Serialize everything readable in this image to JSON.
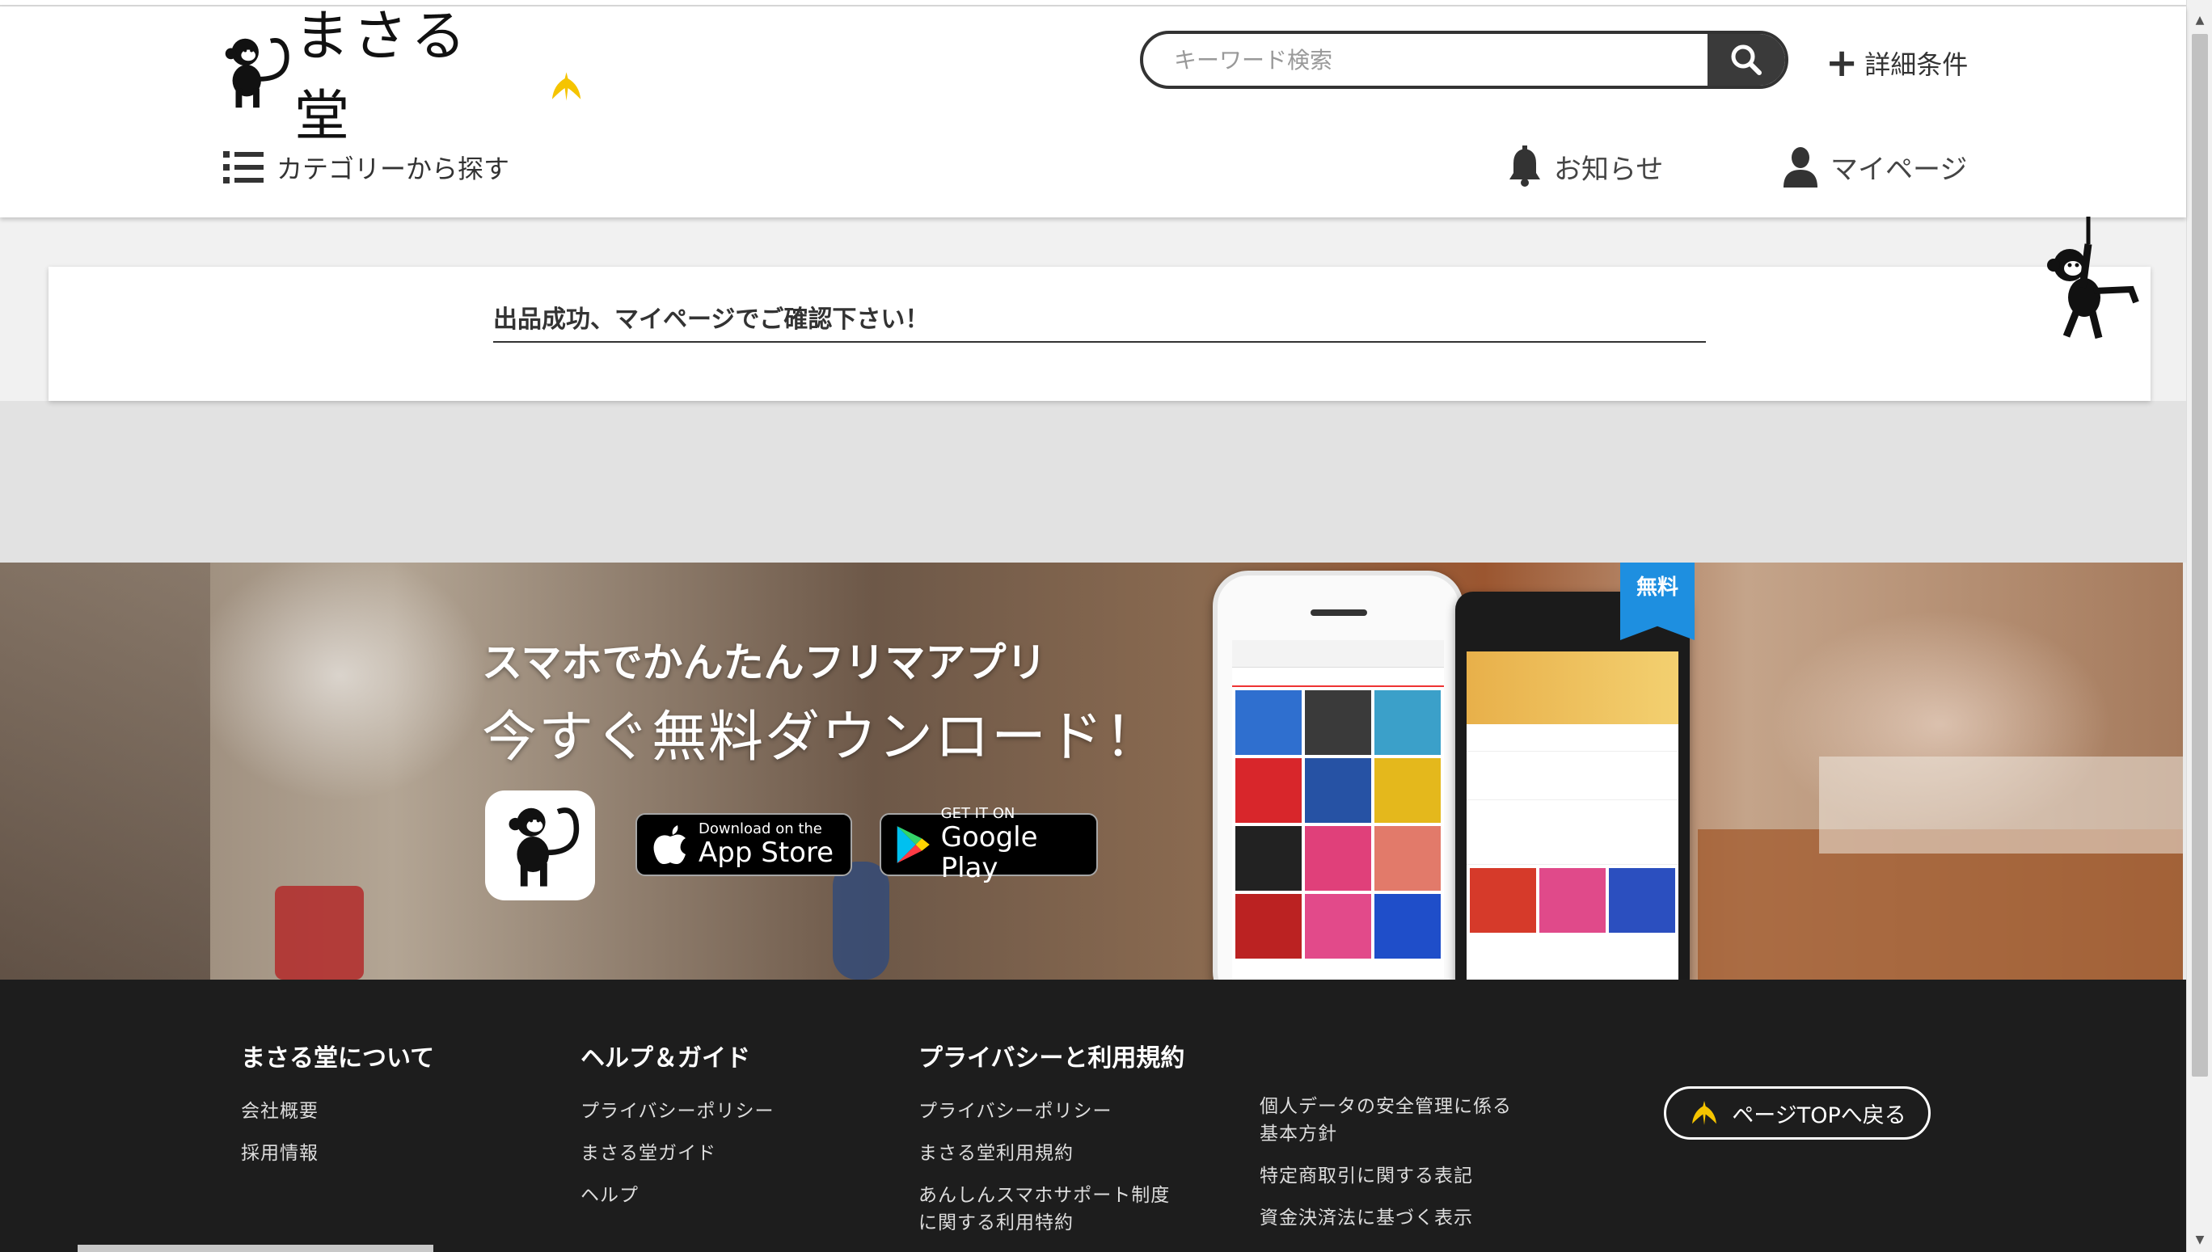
{
  "header": {
    "logo_text": "まさる堂",
    "search_placeholder": "キーワード検索",
    "detail_label": "詳細条件",
    "category_label": "カテゴリーから探す",
    "news_label": "お知らせ",
    "mypage_label": "マイページ"
  },
  "notice": {
    "message": "出品成功、マイページでご確認下さい！"
  },
  "banner": {
    "title_small": "スマホでかんたんフリマアプリ",
    "title_large": "今すぐ無料ダウンロード！",
    "appstore_small": "Download on the",
    "appstore_big": "App Store",
    "googleplay_small": "GET IT ON",
    "googleplay_big": "Google Play",
    "free_badge": "無料"
  },
  "footer": {
    "col1": {
      "title": "まさる堂について",
      "links": [
        "会社概要",
        "採用情報"
      ]
    },
    "col2": {
      "title": "ヘルプ＆ガイド",
      "links": [
        "プライバシーポリシー",
        "まさる堂ガイド",
        "ヘルプ"
      ]
    },
    "col3": {
      "title": "プライバシーと利用規約",
      "links": [
        "プライバシーポリシー",
        "まさる堂利用規約",
        "あんしんスマホサポート制度\nに関する利用特約"
      ]
    },
    "col4": {
      "links": [
        "個人データの安全管理に係る\n基本方針",
        "特定商取引に関する表記",
        "資金決済法に基づく表示"
      ]
    },
    "page_top_label": "ページTOPへ戻る"
  },
  "colors": {
    "header_bg": "#ffffff",
    "footer_bg": "#1d1d1d",
    "search_button": "#3a3a3a",
    "banana": "#f5c400",
    "free_badge": "#1e8fe0"
  }
}
